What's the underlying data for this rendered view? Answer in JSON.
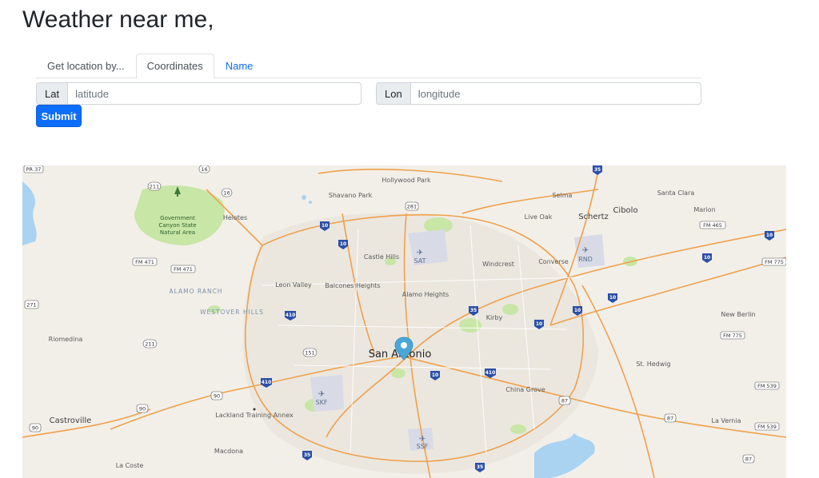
{
  "page": {
    "title": "Weather near me,"
  },
  "tabs": [
    {
      "label": "Get location by...",
      "active": false
    },
    {
      "label": "Coordinates",
      "active": true
    },
    {
      "label": "Name",
      "active": false
    }
  ],
  "form": {
    "lat": {
      "label": "Lat",
      "placeholder": "latitude",
      "value": ""
    },
    "lon": {
      "label": "Lon",
      "placeholder": "longitude",
      "value": ""
    },
    "submit_label": "Submit"
  },
  "map": {
    "center_label": "San Antonio",
    "places": [
      "Hollywood Park",
      "Shavano Park",
      "Selma",
      "Santa Clara",
      "Schertz",
      "Cibolo",
      "Marion",
      "Live Oak",
      "Helotes",
      "Castle Hills",
      "Windcrest",
      "Converse",
      "Leon Valley",
      "Balcones Heights",
      "Alamo Heights",
      "Kirby",
      "New Berlin",
      "Riomedina",
      "St. Hedwig",
      "China Grove",
      "Castroville",
      "La Vernia",
      "Macdona",
      "La Coste"
    ],
    "park": "Government Canyon State Natural Area",
    "areas": [
      "ALAMO RANCH",
      "WESTOVER HILLS"
    ],
    "training_annex": "Lackland Training Annex",
    "airports": [
      "SAT",
      "RND",
      "SKF",
      "SSF"
    ],
    "route_shields": [
      "PR 37",
      "16",
      "211",
      "16",
      "FM 471",
      "FM 471",
      "281",
      "35",
      "10",
      "10",
      "FM 465",
      "10",
      "FM 775",
      "10",
      "271",
      "410",
      "151",
      "35",
      "10",
      "10",
      "10",
      "FM 775",
      "211",
      "410",
      "410",
      "10",
      "90",
      "90",
      "87",
      "FM 539",
      "90",
      "87",
      "FM 539",
      "35",
      "35",
      "87"
    ],
    "marker_color": "#4aa8d8",
    "colors": {
      "highway": "#f0a04b",
      "interstate": "#e8923a",
      "water": "#a9d3f0",
      "park": "#c8e6a6",
      "urban": "#ebe7df",
      "background": "#f2efe9"
    }
  }
}
